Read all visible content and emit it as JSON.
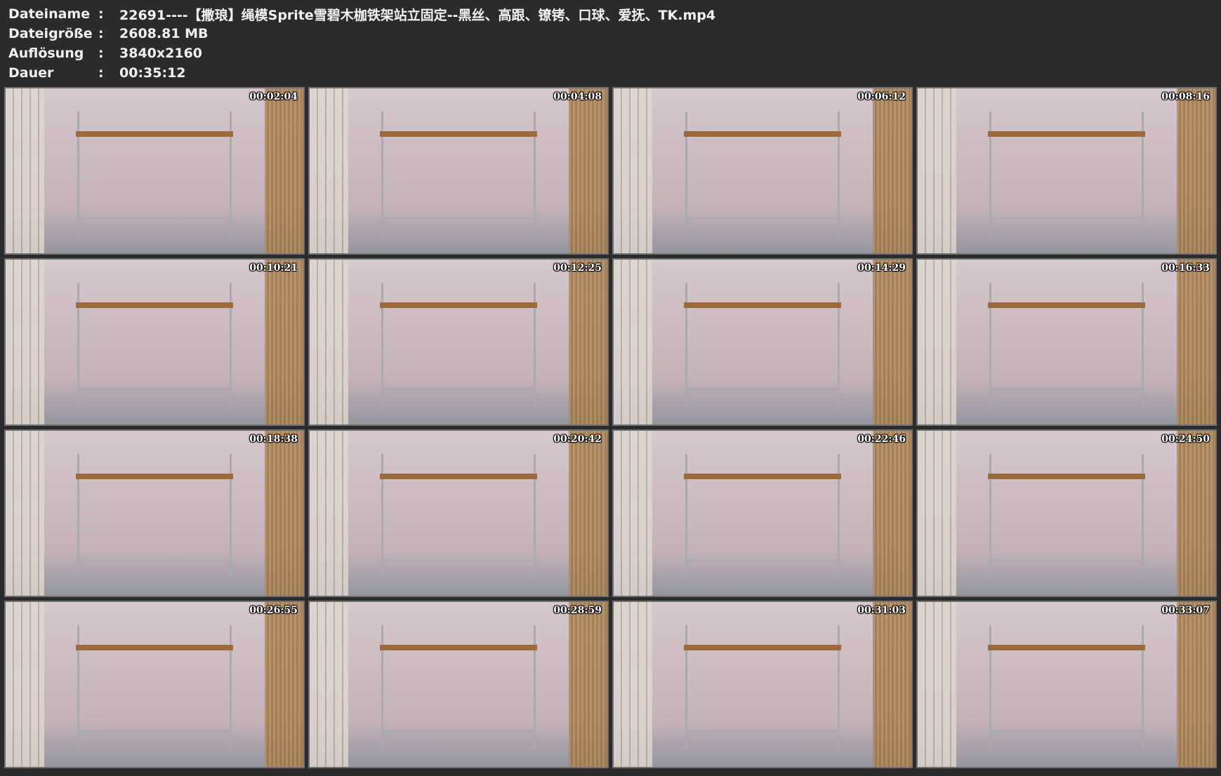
{
  "meta": {
    "filename_label": "Dateiname",
    "filename_value": "22691----【撒琅】绳模Sprite雪碧木枷铁架站立固定--黑丝、高跟、镣铐、口球、爱抚、TK.mp4",
    "size_label": "Dateigröße",
    "size_value": "2608.81 MB",
    "resolution_label": "Auflösung",
    "resolution_value": "3840x2160",
    "duration_label": "Dauer",
    "duration_value": "00:35:12",
    "separator": ":"
  },
  "thumbnails": [
    {
      "timestamp": "00:02:04"
    },
    {
      "timestamp": "00:04:08"
    },
    {
      "timestamp": "00:06:12"
    },
    {
      "timestamp": "00:08:16"
    },
    {
      "timestamp": "00:10:21"
    },
    {
      "timestamp": "00:12:25"
    },
    {
      "timestamp": "00:14:29"
    },
    {
      "timestamp": "00:16:33"
    },
    {
      "timestamp": "00:18:38"
    },
    {
      "timestamp": "00:20:42"
    },
    {
      "timestamp": "00:22:46"
    },
    {
      "timestamp": "00:24:50"
    },
    {
      "timestamp": "00:26:55"
    },
    {
      "timestamp": "00:28:59"
    },
    {
      "timestamp": "00:31:03"
    },
    {
      "timestamp": "00:33:07"
    }
  ],
  "colors": {
    "background": "#2b2b2b",
    "text": "#f2f2f2",
    "thumb_border": "#6f6f6f"
  }
}
